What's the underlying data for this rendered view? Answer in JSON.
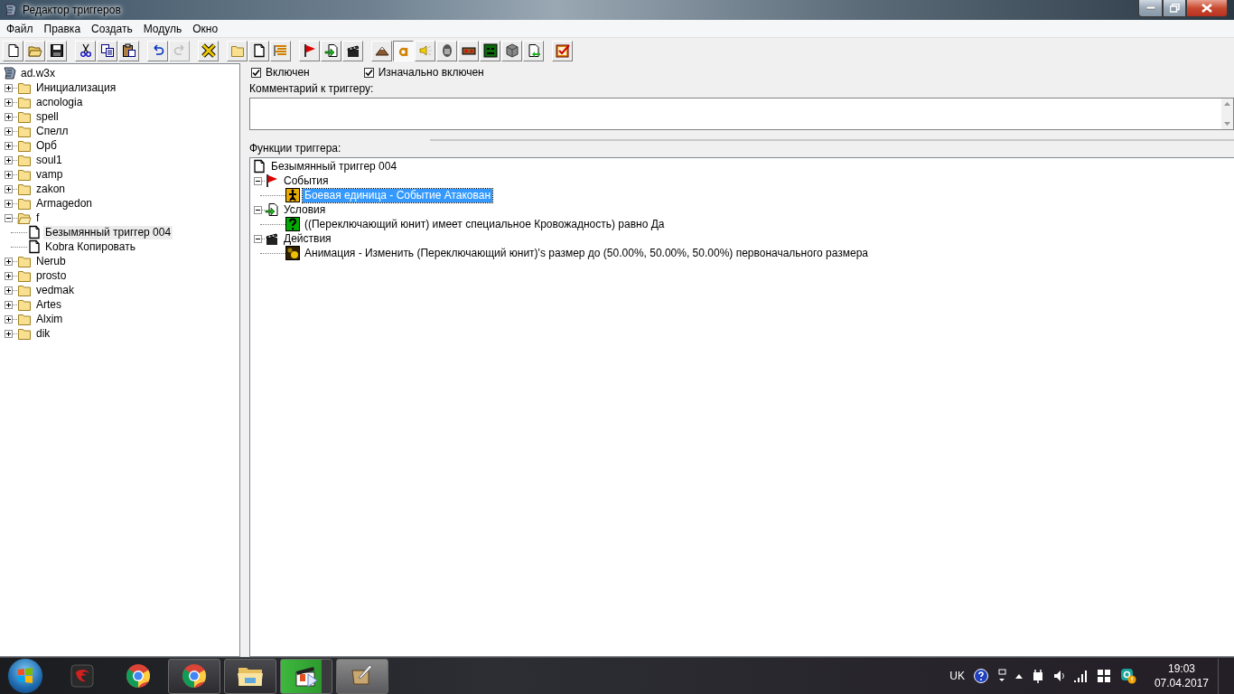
{
  "window": {
    "title": "Редактор триггеров"
  },
  "menu": [
    "Файл",
    "Правка",
    "Создать",
    "Модуль",
    "Окно"
  ],
  "toolbar": [
    [
      {
        "kind": "new"
      },
      {
        "kind": "open"
      },
      {
        "kind": "save"
      }
    ],
    [
      {
        "kind": "cut"
      },
      {
        "kind": "copy"
      },
      {
        "kind": "paste"
      }
    ],
    [
      {
        "kind": "undo",
        "disabled": false
      },
      {
        "kind": "redo",
        "disabled": true
      }
    ],
    [
      {
        "kind": "cross"
      }
    ],
    [
      {
        "kind": "folder"
      },
      {
        "kind": "page"
      },
      {
        "kind": "lines"
      }
    ],
    [
      {
        "kind": "flag"
      },
      {
        "kind": "condition"
      },
      {
        "kind": "clapper"
      }
    ],
    [
      {
        "kind": "terrain",
        "pressed": false
      },
      {
        "kind": "letter",
        "pressed": true
      },
      {
        "kind": "sound",
        "pressed": false
      },
      {
        "kind": "helmet",
        "pressed": false
      },
      {
        "kind": "panel",
        "pressed": false
      },
      {
        "kind": "monster",
        "pressed": false
      },
      {
        "kind": "cube",
        "pressed": false
      },
      {
        "kind": "import",
        "pressed": false
      }
    ],
    [
      {
        "kind": "checklist"
      }
    ]
  ],
  "trigger_tree": {
    "root": "ad.w3x",
    "items": [
      {
        "label": "Инициализация",
        "kind": "folder",
        "expanded": false,
        "selected": false
      },
      {
        "label": "acnologia",
        "kind": "folder",
        "expanded": false,
        "selected": false
      },
      {
        "label": "spell",
        "kind": "folder",
        "expanded": false,
        "selected": false
      },
      {
        "label": "Спелл",
        "kind": "folder",
        "expanded": false,
        "selected": false
      },
      {
        "label": "Орб",
        "kind": "folder",
        "expanded": false,
        "selected": false
      },
      {
        "label": "soul1",
        "kind": "folder",
        "expanded": false,
        "selected": false
      },
      {
        "label": "vamp",
        "kind": "folder",
        "expanded": false,
        "selected": false
      },
      {
        "label": "zakon",
        "kind": "folder",
        "expanded": false,
        "selected": false
      },
      {
        "label": "Armagedon",
        "kind": "folder",
        "expanded": false,
        "selected": false
      },
      {
        "label": "f",
        "kind": "folder",
        "expanded": true,
        "selected": false,
        "children": [
          {
            "label": "Безымянный триггер 004",
            "kind": "trigger",
            "selected": true
          },
          {
            "label": "Kobra Копировать",
            "kind": "trigger",
            "selected": false
          }
        ]
      },
      {
        "label": "Nerub",
        "kind": "folder",
        "expanded": false,
        "selected": false
      },
      {
        "label": "prosto",
        "kind": "folder",
        "expanded": false,
        "selected": false
      },
      {
        "label": "vedmak",
        "kind": "folder",
        "expanded": false,
        "selected": false
      },
      {
        "label": "Artes",
        "kind": "folder",
        "expanded": false,
        "selected": false
      },
      {
        "label": "Alxim",
        "kind": "folder",
        "expanded": false,
        "selected": false
      },
      {
        "label": "dik",
        "kind": "folder",
        "expanded": false,
        "selected": false
      }
    ]
  },
  "options": [
    {
      "label": "Включен",
      "checked": true
    },
    {
      "label": "Изначально включен",
      "checked": true
    }
  ],
  "comment": {
    "label": "Комментарий к триггеру:"
  },
  "functions": {
    "label": "Функции триггера:",
    "root": "Безымянный триггер 004",
    "sections": [
      {
        "kind": "events",
        "label": "События",
        "expanded": true,
        "children": [
          {
            "kind": "unit",
            "label": "Боевая единица - Событие Атакован",
            "selected": true
          }
        ]
      },
      {
        "kind": "conditions",
        "label": "Условия",
        "expanded": true,
        "children": [
          {
            "kind": "question",
            "label": "((Переключающий юнит) имеет специальное Кровожадность) равно Да",
            "selected": false
          }
        ]
      },
      {
        "kind": "actions",
        "label": "Действия",
        "expanded": true,
        "children": [
          {
            "kind": "animation",
            "label": "Анимация - Изменить (Переключающий юнит)'s размер до (50.00%, 50.00%, 50.00%) первоначального размера",
            "selected": false
          }
        ]
      }
    ]
  },
  "taskbar": {
    "apps": [
      {
        "kind": "garena",
        "open": false,
        "active": false,
        "highlighted": false
      },
      {
        "kind": "chrome",
        "open": false,
        "active": false,
        "highlighted": false
      },
      {
        "kind": "chrome",
        "open": true,
        "active": false,
        "highlighted": false
      },
      {
        "kind": "explorer",
        "open": true,
        "active": false,
        "highlighted": false
      },
      {
        "kind": "media",
        "open": true,
        "active": false,
        "highlighted": true
      },
      {
        "kind": "editor",
        "open": true,
        "active": true,
        "highlighted": false
      }
    ],
    "language": "UK",
    "time": "19:03",
    "date": "07.04.2017"
  }
}
